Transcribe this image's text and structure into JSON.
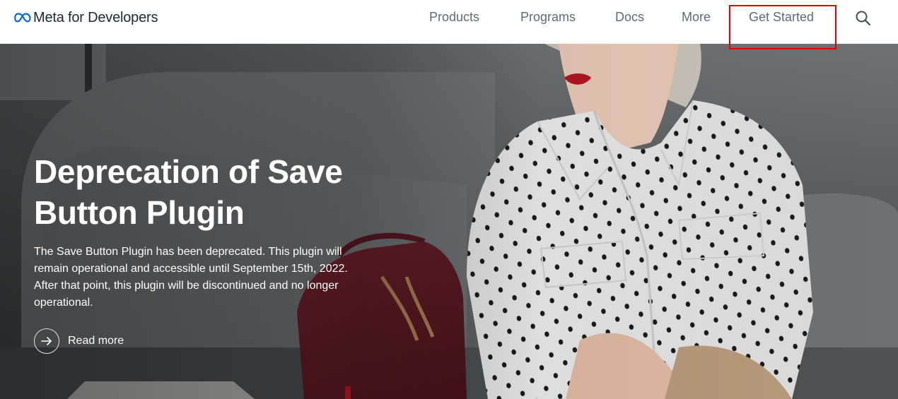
{
  "header": {
    "brand_name": "Meta for Developers",
    "logo_icon": "meta-infinity-logo",
    "nav": [
      {
        "label": "Products"
      },
      {
        "label": "Programs"
      },
      {
        "label": "Docs"
      },
      {
        "label": "More"
      },
      {
        "label": "Get Started"
      }
    ],
    "search_icon": "search-icon",
    "highlight_color": "#e60000"
  },
  "hero": {
    "title_line1": "Deprecation of Save",
    "title_line2": "Button Plugin",
    "description_line1": "The Save Button Plugin has been deprecated. This plugin will",
    "description_line2": "remain operational and accessible until September 15th, 2022.",
    "description_line3": "After that point, this plugin will be discontinued and no longer",
    "description_line4": "operational.",
    "read_more_label": "Read more",
    "read_more_icon": "arrow-right-icon",
    "background_image": "woman in polka-dot blouse on sofa"
  },
  "colors": {
    "nav_text": "#5d6c7b",
    "brand_text": "#1c2b33",
    "hero_text": "#ffffff",
    "meta_blue": "#0668e1"
  }
}
